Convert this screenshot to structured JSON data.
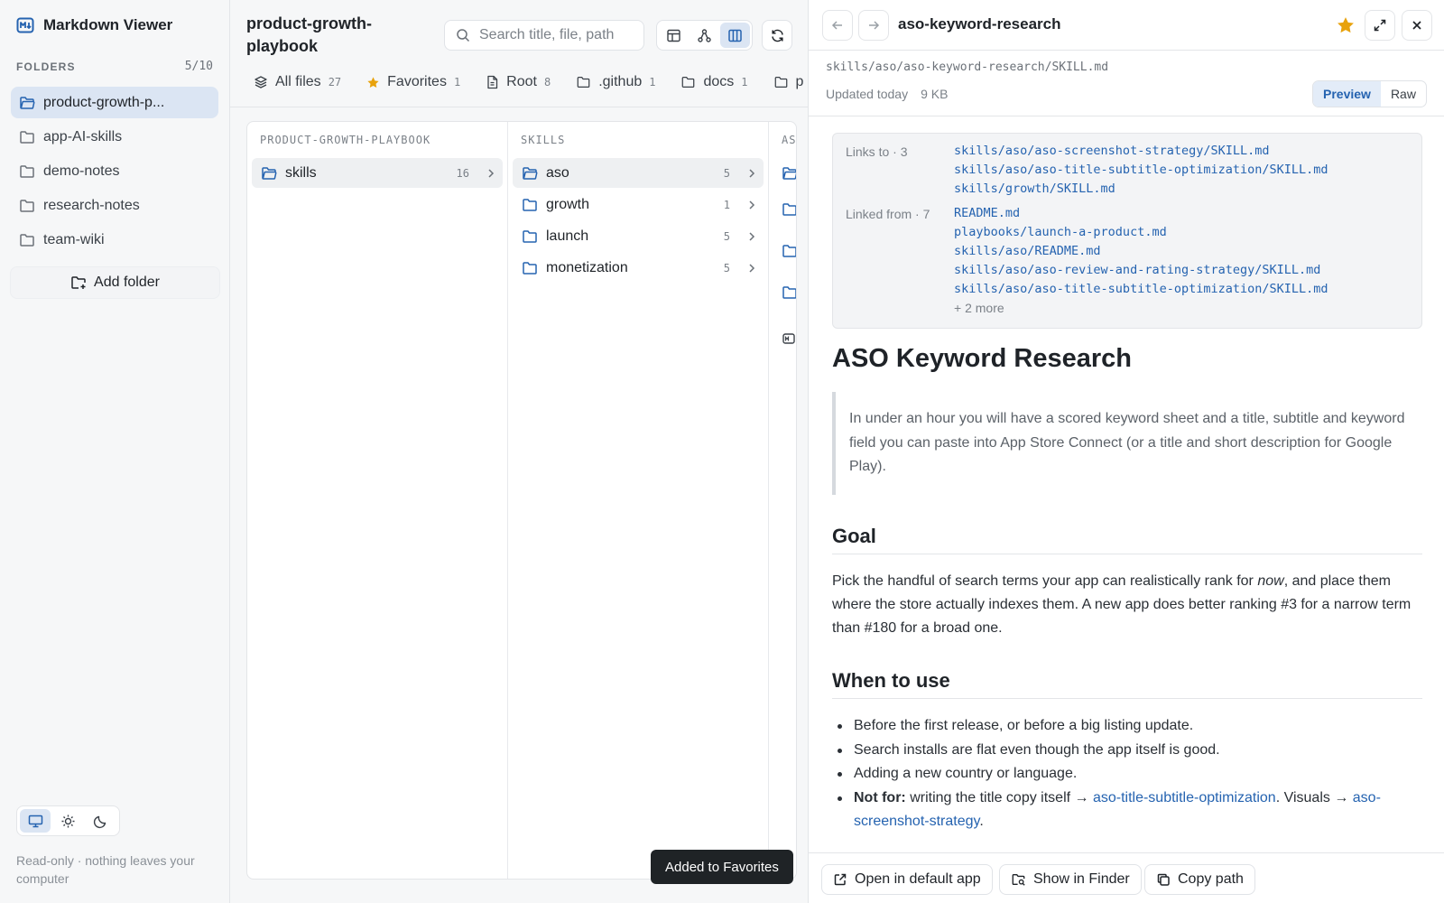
{
  "sidebar": {
    "app_title": "Markdown Viewer",
    "folders_label": "FOLDERS",
    "folders_count": "5/10",
    "folders": [
      {
        "name": "product-growth-p...",
        "active": true
      },
      {
        "name": "app-AI-skills",
        "active": false
      },
      {
        "name": "demo-notes",
        "active": false
      },
      {
        "name": "research-notes",
        "active": false
      },
      {
        "name": "team-wiki",
        "active": false
      }
    ],
    "add_folder_label": "Add folder",
    "theme_options": [
      "system",
      "light",
      "dark"
    ],
    "theme_selected": "system",
    "footer_note": "Read-only · nothing leaves your computer"
  },
  "browser": {
    "title": "product-growth-playbook",
    "search_placeholder": "Search title, file, path",
    "view_modes": [
      "table",
      "graph",
      "columns"
    ],
    "view_selected": "columns",
    "tabs": [
      {
        "label": "All files",
        "count": "27",
        "icon": "layers-icon"
      },
      {
        "label": "Favorites",
        "count": "1",
        "icon": "star-icon"
      },
      {
        "label": "Root",
        "count": "8",
        "icon": "file-icon"
      },
      {
        "label": ".github",
        "count": "1",
        "icon": "folder-icon"
      },
      {
        "label": "docs",
        "count": "1",
        "icon": "folder-icon"
      },
      {
        "label": "p",
        "count": "",
        "icon": "folder-icon"
      }
    ],
    "columns": [
      {
        "header": "PRODUCT-GROWTH-PLAYBOOK",
        "rows": [
          {
            "name": "skills",
            "count": "16",
            "selected": true
          }
        ]
      },
      {
        "header": "SKILLS",
        "rows": [
          {
            "name": "aso",
            "count": "5",
            "selected": true
          },
          {
            "name": "growth",
            "count": "1",
            "selected": false
          },
          {
            "name": "launch",
            "count": "5",
            "selected": false
          },
          {
            "name": "monetization",
            "count": "5",
            "selected": false
          }
        ]
      },
      {
        "header": "AS",
        "rows": []
      }
    ],
    "toast": "Added to Favorites"
  },
  "doc": {
    "title": "aso-keyword-research",
    "favorited": true,
    "star_color": "#e8a20c",
    "path": "skills/aso/aso-keyword-research/SKILL.md",
    "updated": "Updated today",
    "size": "9 KB",
    "mode_preview": "Preview",
    "mode_raw": "Raw",
    "links_to_label": "Links to · 3",
    "links_to": [
      "skills/aso/aso-screenshot-strategy/SKILL.md",
      "skills/aso/aso-title-subtitle-optimization/SKILL.md",
      "skills/growth/SKILL.md"
    ],
    "linked_from_label": "Linked from · 7",
    "linked_from": [
      "README.md",
      "playbooks/launch-a-product.md",
      "skills/aso/README.md",
      "skills/aso/aso-review-and-rating-strategy/SKILL.md",
      "skills/aso/aso-title-subtitle-optimization/SKILL.md"
    ],
    "linked_from_more": "+ 2 more",
    "h1": "ASO Keyword Research",
    "quote": "In under an hour you will have a scored keyword sheet and a title, subtitle and keyword field you can paste into App Store Connect (or a title and short description for Google Play).",
    "goal_heading": "Goal",
    "goal_pre": "Pick the handful of search terms your app can realistically rank for ",
    "goal_em": "now",
    "goal_post": ", and place them where the store actually indexes them. A new app does better ranking #3 for a narrow term than #180 for a broad one.",
    "when_heading": "When to use",
    "bullets": [
      "Before the first release, or before a big listing update.",
      "Search installs are flat even though the app itself is good.",
      "Adding a new country or language."
    ],
    "notfor_label": "Not for:",
    "notfor_text1": " writing the title copy itself → ",
    "notfor_link1": "aso-title-subtitle-optimization",
    "notfor_text2": ". Visuals → ",
    "notfor_link2": "aso-screenshot-strategy",
    "notfor_text3": ".",
    "actions": {
      "open": "Open in default app",
      "finder": "Show in Finder",
      "copy": "Copy path"
    }
  },
  "colors": {
    "accent": "#2563b0",
    "selection": "#dbe5f3",
    "favorite": "#e8a20c"
  }
}
